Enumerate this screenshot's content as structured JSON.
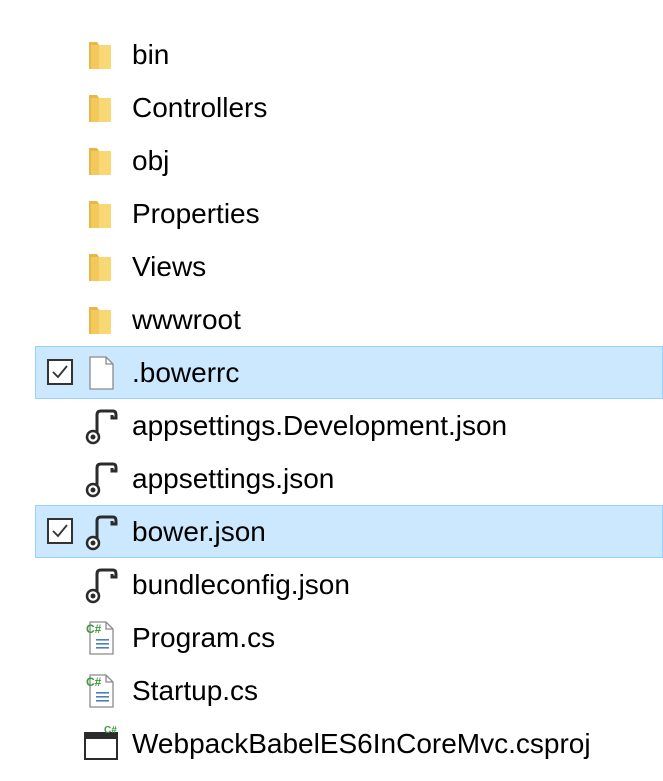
{
  "colors": {
    "selection_fill": "#cce8ff",
    "selection_border": "#99d1ff",
    "folder": "#f8d775",
    "csharp_green": "#3c9a3c"
  },
  "items": [
    {
      "label": "bin",
      "icon": "folder-icon"
    },
    {
      "label": "Controllers",
      "icon": "folder-icon"
    },
    {
      "label": "obj",
      "icon": "folder-icon"
    },
    {
      "label": "Properties",
      "icon": "folder-icon"
    },
    {
      "label": "Views",
      "icon": "folder-icon"
    },
    {
      "label": "wwwroot",
      "icon": "folder-icon"
    },
    {
      "label": ".bowerrc",
      "icon": "blank-file-icon",
      "selected": true,
      "checked": true
    },
    {
      "label": "appsettings.Development.json",
      "icon": "json-file-icon"
    },
    {
      "label": "appsettings.json",
      "icon": "json-file-icon"
    },
    {
      "label": "bower.json",
      "icon": "json-file-icon",
      "selected": true,
      "checked": true
    },
    {
      "label": "bundleconfig.json",
      "icon": "json-file-icon"
    },
    {
      "label": "Program.cs",
      "icon": "csharp-file-icon"
    },
    {
      "label": "Startup.cs",
      "icon": "csharp-file-icon"
    },
    {
      "label": "WebpackBabelES6InCoreMvc.csproj",
      "icon": "csproj-file-icon"
    }
  ]
}
